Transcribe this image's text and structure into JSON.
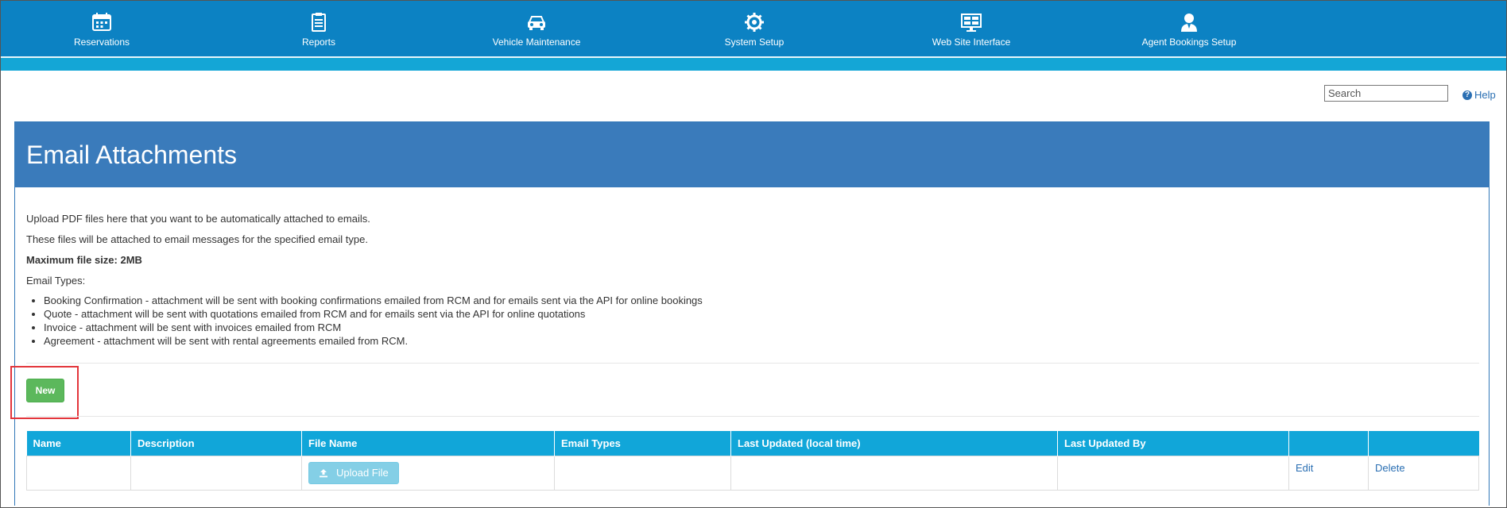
{
  "nav": {
    "items": [
      {
        "label": "Reservations",
        "icon": "calendar-icon"
      },
      {
        "label": "Reports",
        "icon": "clipboard-icon"
      },
      {
        "label": "Vehicle Maintenance",
        "icon": "car-icon"
      },
      {
        "label": "System Setup",
        "icon": "gear-icon"
      },
      {
        "label": "Web Site Interface",
        "icon": "monitor-icon"
      },
      {
        "label": "Agent Bookings Setup",
        "icon": "agent-icon"
      }
    ]
  },
  "search": {
    "placeholder": "Search"
  },
  "help": {
    "label": "Help"
  },
  "page": {
    "title": "Email Attachments",
    "desc1": "Upload PDF files here that you want to be automatically attached to emails.",
    "desc2": "These files will be attached to email messages for the specified email type.",
    "max_size": "Maximum file size: 2MB",
    "types_heading": "Email Types:",
    "types": [
      "Booking Confirmation - attachment will be sent with booking confirmations emailed from RCM and for emails sent via the API for online bookings",
      "Quote - attachment will be sent with quotations emailed from RCM and for emails sent via the API for online quotations",
      "Invoice - attachment will be sent with invoices emailed from RCM",
      "Agreement - attachment will be sent with rental agreements emailed from RCM."
    ],
    "new_label": "New"
  },
  "table": {
    "headers": [
      "Name",
      "Description",
      "File Name",
      "Email Types",
      "Last Updated (local time)",
      "Last Updated By",
      "",
      ""
    ],
    "row": {
      "upload_label": "Upload File",
      "edit_label": "Edit",
      "delete_label": "Delete"
    }
  },
  "colors": {
    "nav_bg": "#0c82c3",
    "header_bg": "#3a7bbb",
    "table_header": "#11a6d9",
    "new_button": "#5cb85c",
    "highlight": "#e3353b"
  }
}
